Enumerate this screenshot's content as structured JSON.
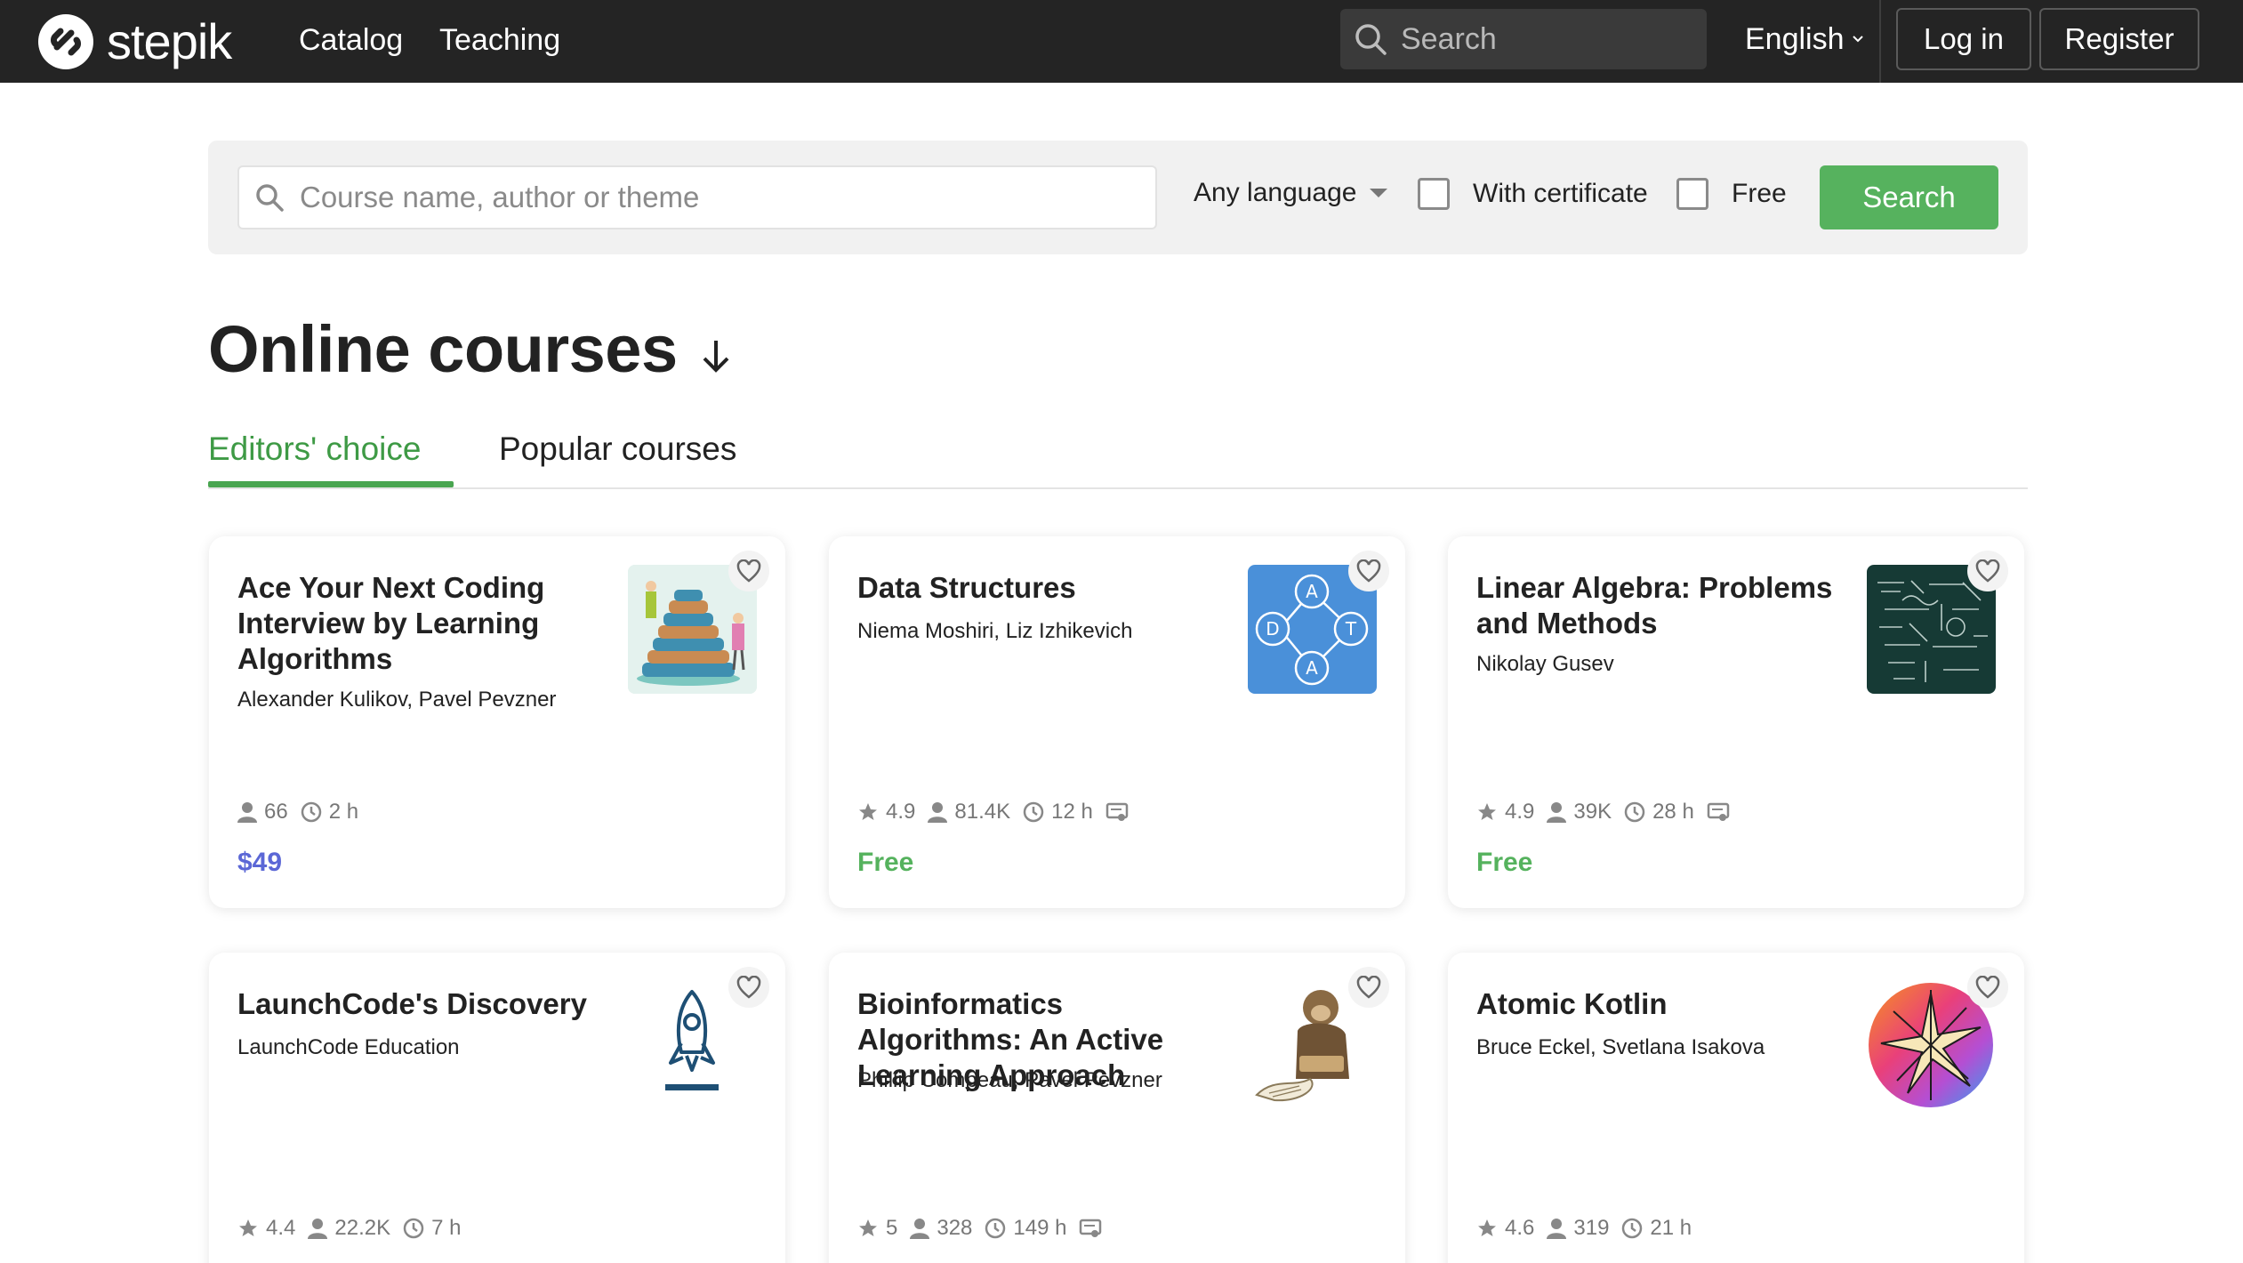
{
  "header": {
    "logo_text": "stepik",
    "nav": [
      "Catalog",
      "Teaching"
    ],
    "search_placeholder": "Search",
    "language": "English",
    "login": "Log in",
    "register": "Register"
  },
  "filters": {
    "search_placeholder": "Course name, author or theme",
    "language": "Any language",
    "certificate_label": "With certificate",
    "free_label": "Free",
    "search_button": "Search"
  },
  "page": {
    "title": "Online courses"
  },
  "tabs": [
    {
      "label": "Editors' choice",
      "active": true
    },
    {
      "label": "Popular courses",
      "active": false
    }
  ],
  "courses": [
    {
      "title": "Ace Your Next Coding Interview by Learning Algorithms",
      "authors": "Alexander Kulikov, Pavel Pevzner",
      "learners": "66",
      "duration": "2 h",
      "price": "$49",
      "thumb_icon": "tower-of-hanoi-image"
    },
    {
      "title": "Data Structures",
      "authors": "Niema Moshiri, Liz Izhikevich",
      "rating": "4.9",
      "learners": "81.4K",
      "duration": "12 h",
      "certificate": true,
      "price": "Free",
      "thumb_icon": "graph-nodes-image"
    },
    {
      "title": "Linear Algebra: Problems and Methods",
      "authors": "Nikolay Gusev",
      "rating": "4.9",
      "learners": "39K",
      "duration": "28 h",
      "certificate": true,
      "price": "Free",
      "thumb_icon": "chalkboard-image"
    },
    {
      "title": "LaunchCode's Discovery",
      "authors": "LaunchCode Education",
      "rating": "4.4",
      "learners": "22.2K",
      "duration": "7 h",
      "thumb_icon": "rocket-image"
    },
    {
      "title": "Bioinformatics Algorithms: An Active Learning Approach",
      "authors": "Phillip Compeau, Pavel Pevzner",
      "rating": "5",
      "learners": "328",
      "duration": "149 h",
      "certificate": true,
      "thumb_icon": "monkey-reading-image"
    },
    {
      "title": "Atomic Kotlin",
      "authors": "Bruce Eckel, Svetlana Isakova",
      "rating": "4.6",
      "learners": "319",
      "duration": "21 h",
      "thumb_icon": "kotlin-burst-image"
    }
  ],
  "colors": {
    "header_bg": "#242424",
    "accent_green": "#56b25e",
    "price_paid": "#5b67d6"
  }
}
